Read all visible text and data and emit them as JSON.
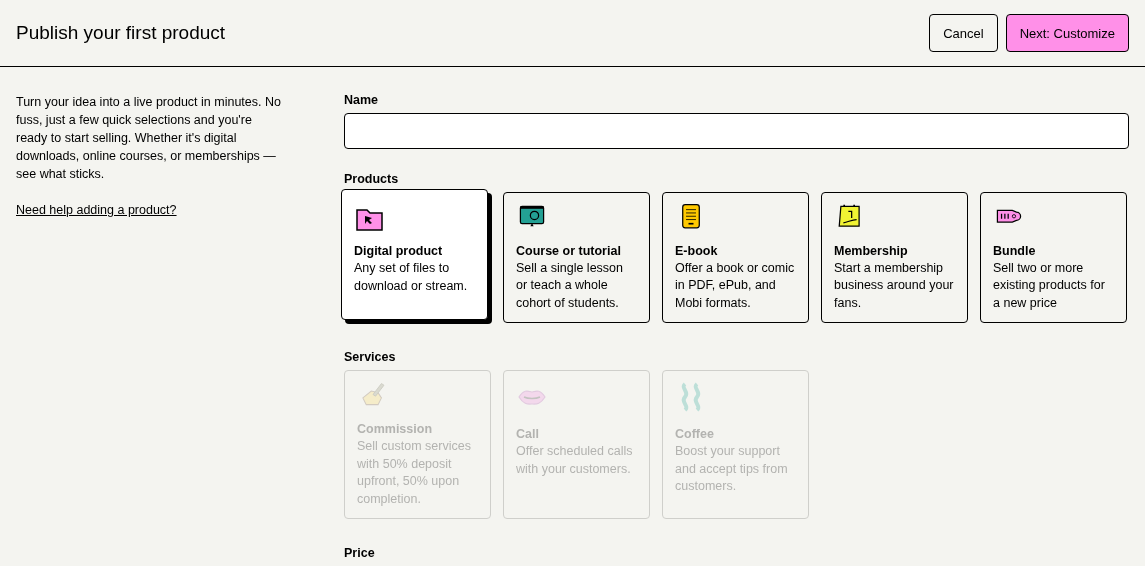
{
  "header": {
    "title": "Publish your first product",
    "buttons": [
      {
        "label": "Cancel",
        "kind": "secondary"
      },
      {
        "label": "Next: Customize",
        "kind": "primary"
      }
    ]
  },
  "intro": {
    "text": "Turn your idea into a live product in minutes. No fuss, just a few quick selections and you're ready to start selling. Whether it's digital downloads, online courses, or memberships — see what sticks.",
    "help_link": "Need help adding a product?"
  },
  "name_field": {
    "label": "Name"
  },
  "sections": [
    {
      "title": "Products",
      "cards": [
        {
          "title": "Digital product",
          "description": "Any set of files to download or stream.",
          "selected": true,
          "disabled": false
        },
        {
          "title": "Course or tutorial",
          "description": "Sell a single lesson or teach a whole cohort of students.",
          "selected": false,
          "disabled": false
        },
        {
          "title": "E-book",
          "description": "Offer a book or comic in PDF, ePub, and Mobi formats.",
          "selected": false,
          "disabled": false
        },
        {
          "title": "Membership",
          "description": "Start a membership business around your fans.",
          "selected": false,
          "disabled": false
        },
        {
          "title": "Bundle",
          "description": "Sell two or more existing products for a new price",
          "selected": false,
          "disabled": false
        }
      ]
    },
    {
      "title": "Services",
      "cards": [
        {
          "title": "Commission",
          "description": "Sell custom services with 50% deposit upfront, 50% upon completion.",
          "selected": false,
          "disabled": true
        },
        {
          "title": "Call",
          "description": "Offer scheduled calls with your customers.",
          "selected": false,
          "disabled": true
        },
        {
          "title": "Coffee",
          "description": "Boost your support and accept tips from customers.",
          "selected": false,
          "disabled": true
        }
      ]
    },
    {
      "title": "Price"
    }
  ]
}
